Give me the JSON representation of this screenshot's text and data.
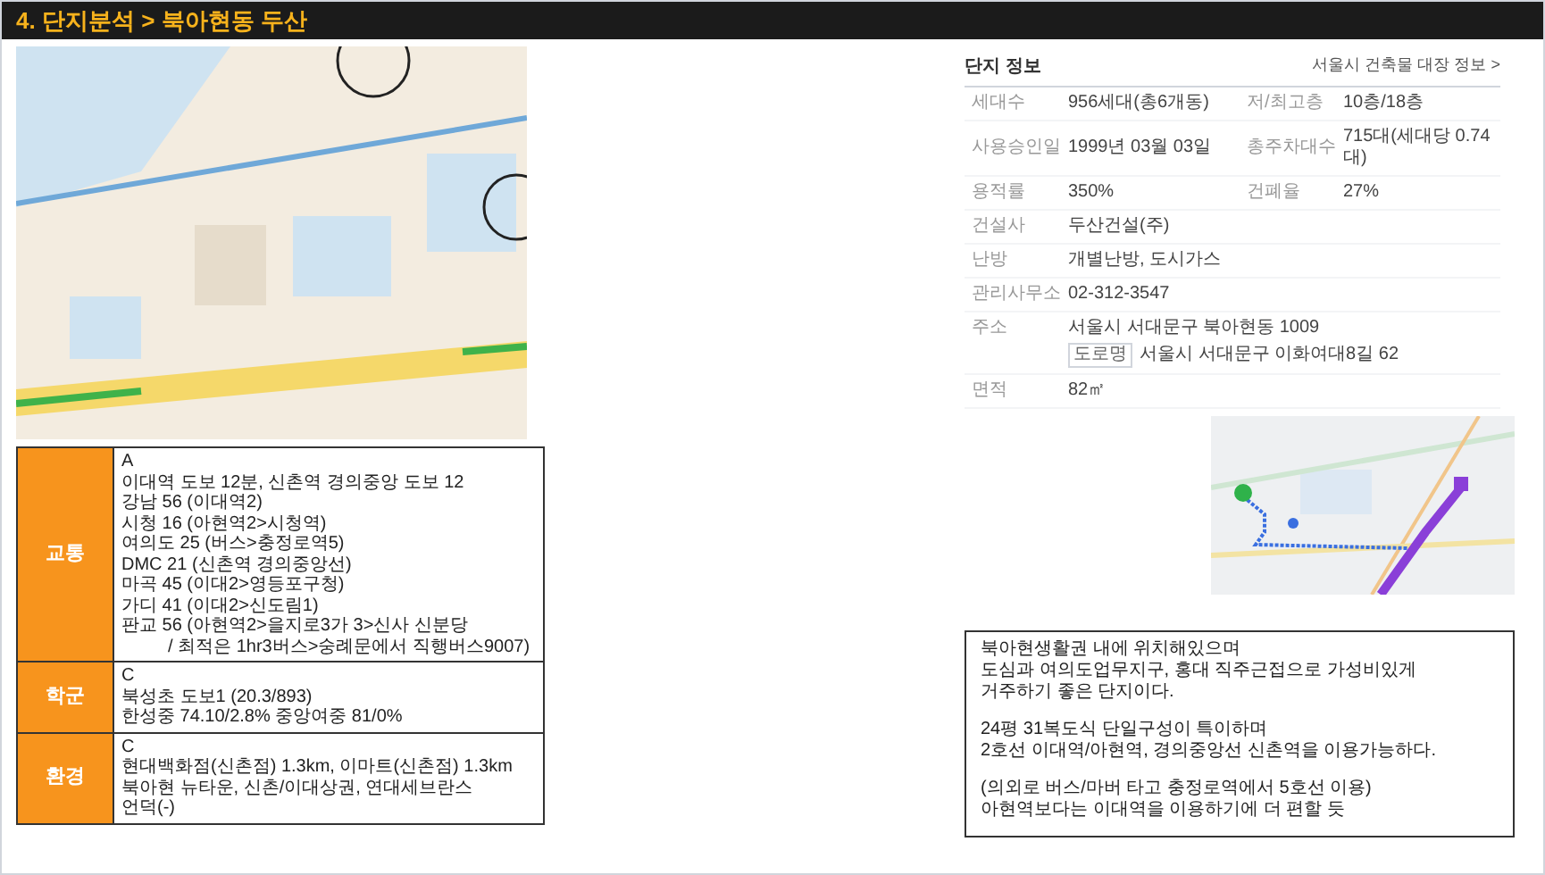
{
  "title": "4. 단지분석 > 북아현동 두산",
  "complex_info": {
    "title": "단지 정보",
    "link": "서울시 건축물 대장 정보 >",
    "rows": [
      {
        "kind": "pair",
        "cells": [
          {
            "label": "세대수",
            "value": "956세대(총6개동)"
          },
          {
            "label": "저/최고층",
            "value": "10층/18층"
          }
        ]
      },
      {
        "kind": "pair",
        "cells": [
          {
            "label": "사용승인일",
            "value": "1999년 03월 03일"
          },
          {
            "label": "총주차대수",
            "value": "715대(세대당 0.74대)"
          }
        ]
      },
      {
        "kind": "pair",
        "cells": [
          {
            "label": "용적률",
            "value": "350%"
          },
          {
            "label": "건폐율",
            "value": "27%"
          }
        ]
      },
      {
        "kind": "single",
        "label": "건설사",
        "value": "두산건설(주)"
      },
      {
        "kind": "single",
        "label": "난방",
        "value": "개별난방, 도시가스"
      },
      {
        "kind": "single",
        "label": "관리사무소",
        "value": "02-312-3547"
      },
      {
        "kind": "address",
        "label": "주소",
        "value": "서울시 서대문구 북아현동 1009",
        "badge": "도로명",
        "road_value": "서울시 서대문구 이화여대8길 62"
      },
      {
        "kind": "single",
        "label": "면적",
        "value": "82㎡"
      }
    ]
  },
  "evaluation": [
    {
      "category": "교통",
      "grade": "A",
      "lines": [
        {
          "text": "이대역 도보 12분, 신촌역 경의중앙 도보 12",
          "indented": false
        },
        {
          "text": "강남 56 (이대역2)",
          "indented": false
        },
        {
          "text": "시청 16 (아현역2>시청역)",
          "indented": false
        },
        {
          "text": "여의도 25 (버스>충정로역5)",
          "indented": false
        },
        {
          "text": "DMC 21 (신촌역 경의중앙선)",
          "indented": false
        },
        {
          "text": "마곡 45 (이대2>영등포구청)",
          "indented": false
        },
        {
          "text": "가디 41 (이대2>신도림1)",
          "indented": false
        },
        {
          "text": "판교 56 (아현역2>을지로3가 3>신사 신분당",
          "indented": false
        },
        {
          "text": "/ 최적은 1hr3버스>숭례문에서 직행버스9007)",
          "indented": true
        }
      ]
    },
    {
      "category": "학군",
      "grade": "C",
      "lines": [
        {
          "text": "북성초 도보1 (20.3/893)",
          "indented": false
        },
        {
          "text": "한성중 74.10/2.8% 중앙여중 81/0%",
          "indented": false
        }
      ]
    },
    {
      "category": "환경",
      "grade": "C",
      "lines": [
        {
          "text": "현대백화점(신촌점) 1.3km, 이마트(신촌점) 1.3km",
          "indented": false
        },
        {
          "text": "북아현 뉴타운, 신촌/이대상권, 연대세브란스",
          "indented": false
        },
        {
          "text": "언덕(-)",
          "indented": false
        }
      ]
    }
  ],
  "summary": [
    [
      "북아현생활권 내에 위치해있으며",
      "도심과 여의도업무지구, 홍대 직주근접으로 가성비있게",
      "거주하기 좋은 단지이다."
    ],
    [
      "24평 31복도식 단일구성이 특이하며",
      "2호선 이대역/아현역, 경의중앙선 신촌역을 이용가능하다."
    ],
    [
      "(의외로 버스/마버 타고 충정로역에서 5호선 이용)",
      "아현역보다는 이대역을 이용하기에 더 편할 듯"
    ]
  ]
}
